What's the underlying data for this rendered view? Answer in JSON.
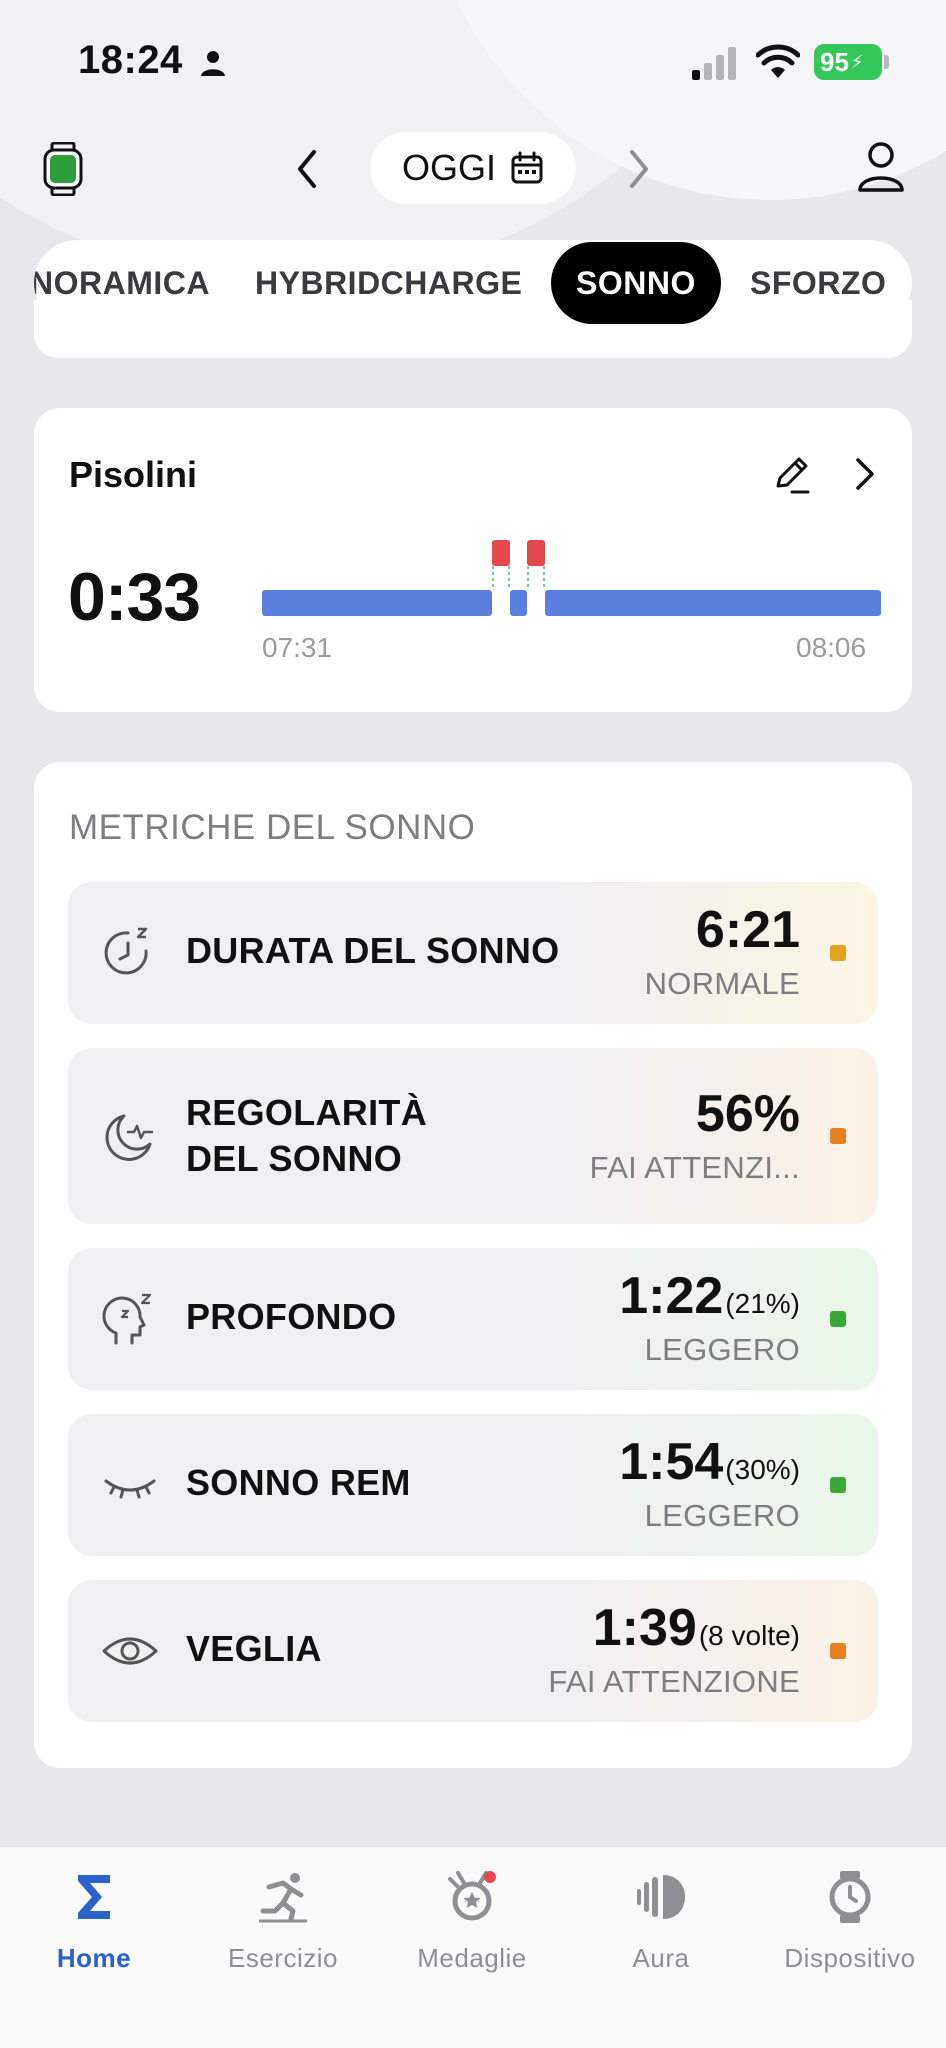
{
  "status_bar": {
    "time": "18:24",
    "battery": "95"
  },
  "header": {
    "date_label": "OGGI"
  },
  "tabs": [
    {
      "label": "NORAMICA",
      "active": false
    },
    {
      "label": "HYBRIDCHARGE",
      "active": false
    },
    {
      "label": "SONNO",
      "active": true
    },
    {
      "label": "SFORZO",
      "active": false
    }
  ],
  "naps": {
    "title": "Pisolini",
    "duration": "0:33",
    "start_time": "07:31",
    "end_time": "08:06"
  },
  "metrics": {
    "title": "METRICHE DEL SONNO",
    "rows": [
      {
        "label": "DURATA DEL SONNO",
        "value": "6:21",
        "extra": "",
        "status": "NORMALE",
        "dot_color": "#e5a21c",
        "icon": "clock-zz-icon"
      },
      {
        "label_line1": "REGOLARITÀ",
        "label_line2": "DEL SONNO",
        "value": "56%",
        "extra": "",
        "status": "FAI ATTENZI...",
        "dot_color": "#e87e1e",
        "icon": "moon-pulse-icon"
      },
      {
        "label": "PROFONDO",
        "value": "1:22",
        "extra": "(21%)",
        "status": "LEGGERO",
        "dot_color": "#3aa835",
        "icon": "head-zz-icon"
      },
      {
        "label": "SONNO REM",
        "value": "1:54",
        "extra": "(30%)",
        "status": "LEGGERO",
        "dot_color": "#3aa835",
        "icon": "closed-eye-icon"
      },
      {
        "label": "VEGLIA",
        "value": "1:39",
        "extra": "(8 volte)",
        "status": "FAI ATTENZIONE",
        "dot_color": "#e87e1e",
        "icon": "eye-icon"
      }
    ]
  },
  "bottom_nav": [
    {
      "label": "Home",
      "active": true,
      "icon": "sigma-icon"
    },
    {
      "label": "Esercizio",
      "active": false,
      "icon": "runner-icon"
    },
    {
      "label": "Medaglie",
      "active": false,
      "icon": "medal-icon"
    },
    {
      "label": "Aura",
      "active": false,
      "icon": "aura-icon"
    },
    {
      "label": "Dispositivo",
      "active": false,
      "icon": "watch-icon"
    }
  ],
  "colors": {
    "accent_blue": "#2a62c9",
    "chart_blue": "#5a7fde",
    "chart_red": "#e5484d",
    "battery_green": "#34c759"
  }
}
